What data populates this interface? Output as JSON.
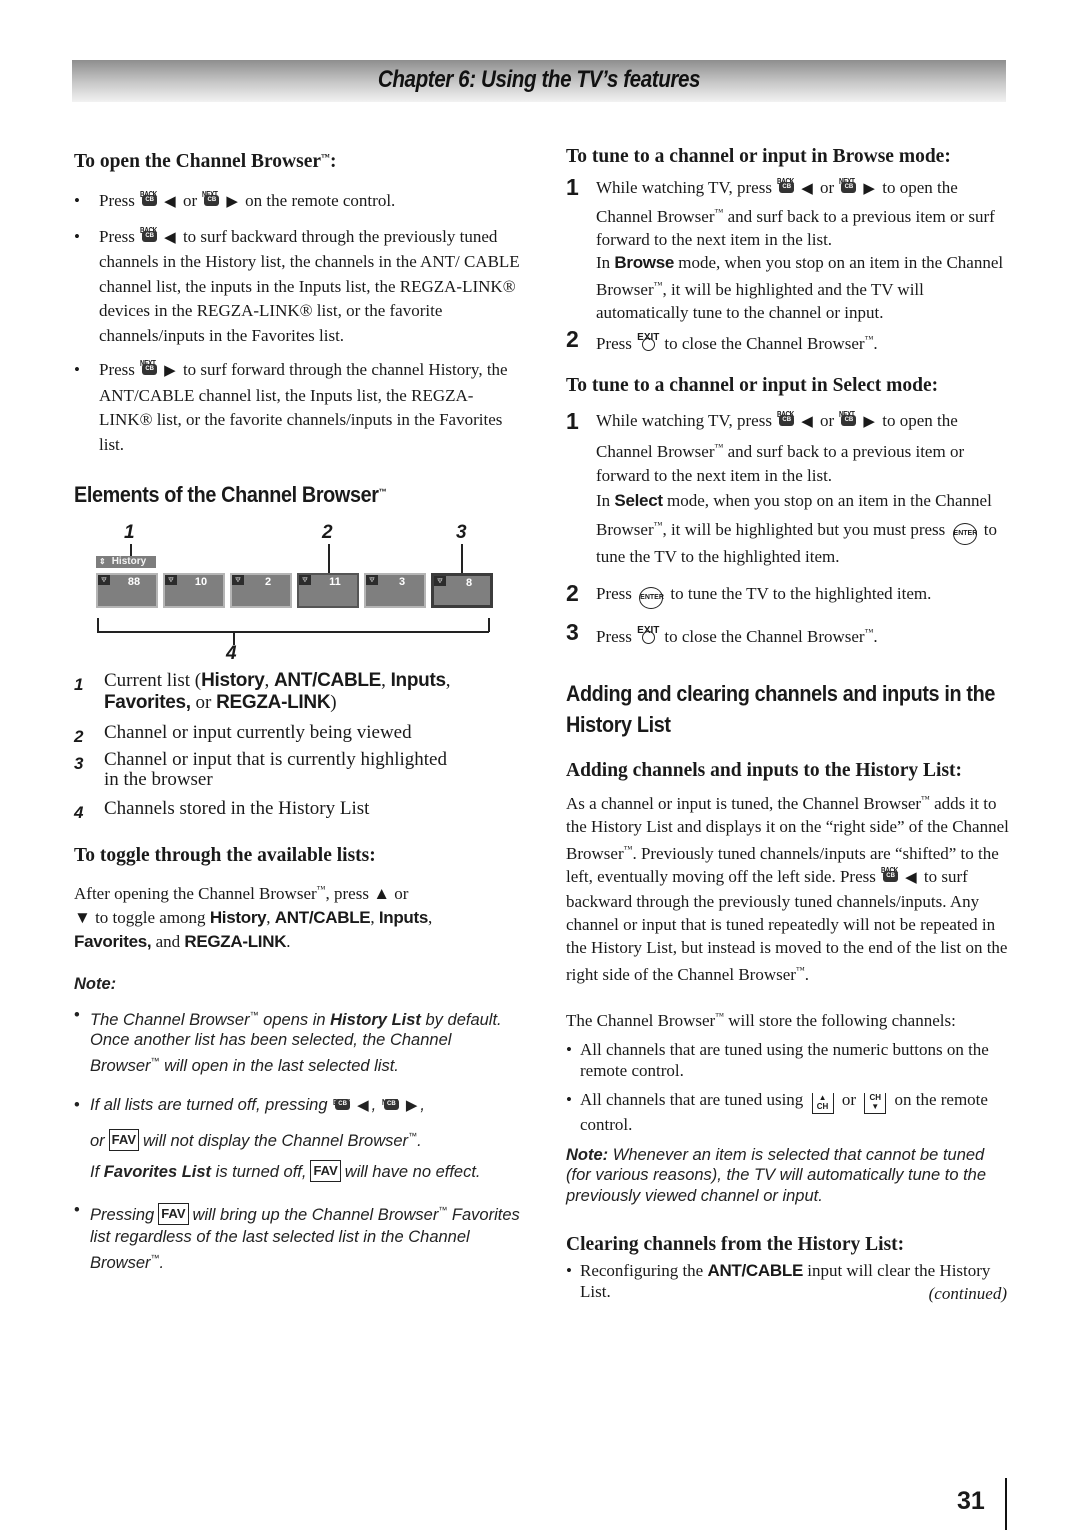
{
  "header": {
    "chapter_title": "Chapter 6: Using the TV’s features"
  },
  "icons": {
    "back_label": "BACK",
    "next_label": "NEXT",
    "cb_label": "CB",
    "exit_label": "EXIT",
    "enter_label": "ENTER",
    "fav_label": "FAV",
    "ch_label": "CH",
    "left_arrow": "◀",
    "right_arrow": "▶",
    "up_arrow": "▲",
    "down_arrow": "▼",
    "bullet": "•",
    "tm": "™",
    "reg": "®"
  },
  "left": {
    "open_heading": "To open the Channel Browser",
    "open_bullets": [
      {
        "pre": "Press",
        "mid": "or",
        "post": "on the remote control."
      },
      {
        "pre": "Press",
        "post": "to surf backward through the previously tuned channels in the History list, the channels in the ANT/ CABLE channel list, the inputs in the Inputs list, the REGZA-LINK® devices in the REGZA-LINK® list, or the favorite channels/inputs in the Favorites list."
      },
      {
        "pre": "Press",
        "post": "to surf forward through the channel History, the ANT/CABLE channel list, the Inputs list, the REGZA-LINK® list, or the favorite channels/inputs in the Favorites list."
      }
    ],
    "elements_heading": "Elements of the Channel Browser",
    "diagram": {
      "callouts": [
        "1",
        "2",
        "3",
        "4"
      ],
      "list_tag": "History",
      "tiles": [
        {
          "channel": "88",
          "state": "normal"
        },
        {
          "channel": "10",
          "state": "normal"
        },
        {
          "channel": "2",
          "state": "normal"
        },
        {
          "channel": "11",
          "state": "current"
        },
        {
          "channel": "3",
          "state": "normal"
        },
        {
          "channel": "8",
          "state": "highlighted"
        }
      ]
    },
    "legend": [
      {
        "num": "1",
        "text_a": "Current list (",
        "b1": "History",
        "c1": ", ",
        "b2": "ANT/CABLE",
        "c2": ", ",
        "b3": "Inputs",
        "c3": ",",
        "b4": "Favorites,",
        "c4": " or ",
        "b5": "REGZA-LINK",
        "c5": ")"
      },
      {
        "num": "2",
        "text": "Channel or input currently being viewed"
      },
      {
        "num": "3",
        "text": "Channel or input that is currently highlighted in the browser"
      },
      {
        "num": "4",
        "text": "Channels stored in the History List"
      }
    ],
    "toggle_heading": "To toggle through the available lists:",
    "toggle_text": {
      "a": "After opening the Channel Browser",
      "b": ", press",
      "c": "or",
      "d": "to toggle among",
      "e": "History",
      "f": ", ",
      "g": "ANT/CABLE",
      "h": ", ",
      "i": "Inputs",
      "j": ",",
      "k": "Favorites,",
      "l": " and ",
      "m": "REGZA-LINK",
      "n": "."
    },
    "note_heading": "Note:",
    "notes": {
      "n1": {
        "a": "The Channel Browser",
        "b": " opens in ",
        "c": "History List",
        "d": " by default. Once another list has been selected, the Channel Browser",
        "e": " will open in the last selected list."
      },
      "n2": {
        "a": "If all lists are turned off, pressing",
        "b": ",",
        "c": ",",
        "d": "or",
        "e": "will not display the Channel Browser",
        "f": ".",
        "g": "If ",
        "h": "Favorites List",
        "i": " is turned off,",
        "j": "will have no effect."
      },
      "n3": {
        "a": "Pressing",
        "b": "will bring up the Channel Browser",
        "c": " Favorites list regardless of the last selected list in the Channel Browser",
        "d": "."
      }
    }
  },
  "right": {
    "browse_heading": "To tune to a channel or input in Browse mode:",
    "browse_steps": [
      {
        "num": "1",
        "a": "While watching TV, press",
        "b": "or",
        "c": "to open the Channel Browser",
        "d": " and surf back to a previous item or surf forward to the next item in the list.",
        "e": "In ",
        "f": "Browse",
        "g": " mode, when you stop on an item in the Channel Browser",
        "h": ", it will be highlighted and the TV will automatically tune to the channel or input."
      },
      {
        "num": "2",
        "a": "Press",
        "b": "to close the Channel Browser",
        "c": "."
      }
    ],
    "select_heading": "To tune to a channel or input in Select mode:",
    "select_steps": [
      {
        "num": "1",
        "a": "While watching TV, press",
        "b": "or",
        "c": "to open the Channel Browser",
        "d": " and surf back to a previous item or forward to the next item in the list.",
        "e": "In ",
        "f": "Select",
        "g": " mode, when you stop on an item in the Channel Browser",
        "h": ", it will be highlighted but you must press",
        "i": "to tune the TV to the highlighted item."
      },
      {
        "num": "2",
        "a": "Press",
        "b": "to tune the TV to the highlighted item."
      },
      {
        "num": "3",
        "a": "Press",
        "b": "to close the Channel Browser",
        "c": "."
      }
    ],
    "history_heading": "Adding and clearing channels and inputs in the History List",
    "adding_heading": "Adding channels and inputs to the History List:",
    "adding_text": {
      "a": "As a channel or input is tuned, the Channel Browser",
      "b": " adds it to the History List and displays it on the “right side” of the Channel Browser",
      "c": ". Previously tuned channels/inputs are “shifted” to the left, eventually moving off the left side. Press",
      "d": "to surf backward through the previously tuned channels/inputs. Any channel or input that is tuned repeatedly will not be repeated in the History List, but instead is moved to the end of the list on the right side of the Channel Browser",
      "e": "."
    },
    "store_text": {
      "a": "The Channel Browser",
      "b": " will store the following channels:"
    },
    "store_bullets": [
      {
        "text": "All channels that are tuned using the numeric buttons on the remote control."
      },
      {
        "a": "All channels that are tuned using",
        "b": "or",
        "c": "on the remote control."
      }
    ],
    "note": {
      "label": "Note:",
      "text": " Whenever an item is selected that cannot be tuned (for various reasons), the TV will automatically tune to the previously viewed channel or input."
    },
    "clearing_heading": "Clearing channels from the History List:",
    "clearing_bullet": {
      "a": "Reconfiguring the ",
      "b": "ANT/CABLE",
      "c": " input will clear the History List."
    },
    "continued": "(continued)"
  },
  "footer": {
    "page_number": "31"
  }
}
